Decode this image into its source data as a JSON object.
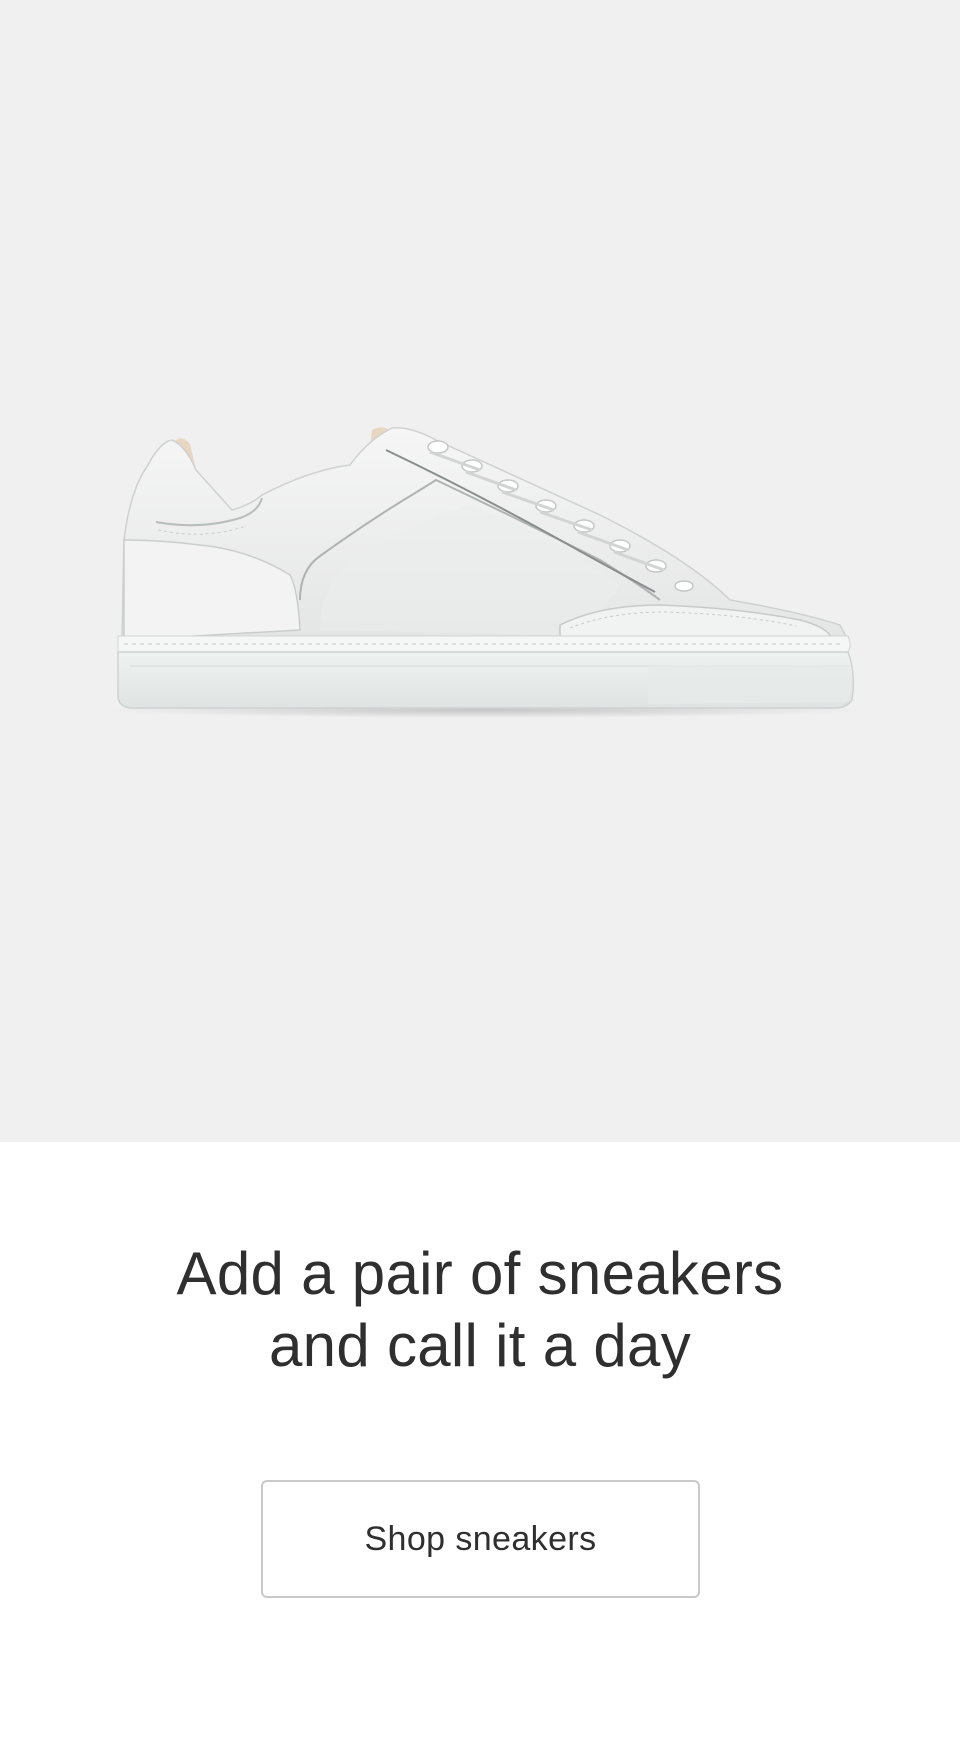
{
  "hero": {
    "image_alt": "white leather low-top sneaker",
    "background_color": "#f0f0f0"
  },
  "promo": {
    "headline_line1": "Add a pair of sneakers",
    "headline_line2": "and call it a day",
    "cta_label": "Shop sneakers"
  }
}
